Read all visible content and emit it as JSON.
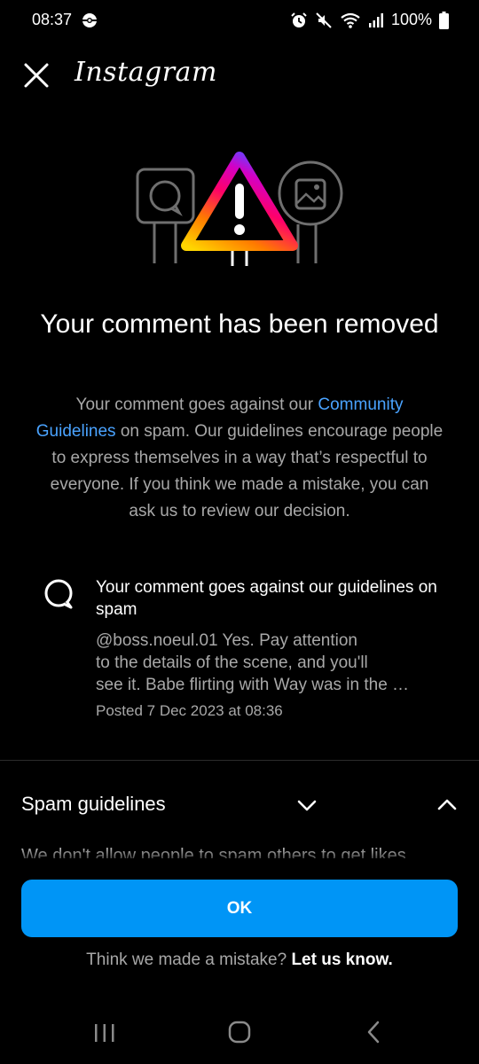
{
  "status_bar": {
    "time": "08:37",
    "battery": "100%"
  },
  "app_bar": {
    "logo": "Instagram",
    "close_icon": "close-icon"
  },
  "hero": {
    "icons": [
      "comment-sign-icon",
      "warning-triangle-icon",
      "image-sign-icon"
    ],
    "gradient": [
      "#ffd600",
      "#ff7a00",
      "#ff0069",
      "#d300c5",
      "#7638fa"
    ]
  },
  "main": {
    "title": "Your comment has been removed",
    "desc_before": "Your comment goes against our ",
    "desc_link": "Community Guidelines",
    "desc_after": " on spam. Our guidelines encourage people to express themselves in a way that’s respectful to everyone. If you think we made a mistake, you can ask us to review our decision."
  },
  "comment": {
    "heading": "Your comment goes against our guidelines on spam",
    "text_lines": [
      "@boss.noeul.01 Yes. Pay attention",
      "to the details of the scene, and you'll",
      "see it. Babe flirting with Way was in the …"
    ],
    "posted": "Posted 7 Dec 2023 at 08:36"
  },
  "guidelines": {
    "title": "Spam guidelines",
    "preview": "We don't allow people to spam others to get likes"
  },
  "actions": {
    "ok_label": "OK",
    "mistake_text": "Think we made a mistake?",
    "let_us_know": "Let us know."
  },
  "colors": {
    "background": "#000000",
    "accent_blue": "#0095f6",
    "link_blue": "#4aa3ff",
    "secondary_text": "#a8a8a8"
  }
}
